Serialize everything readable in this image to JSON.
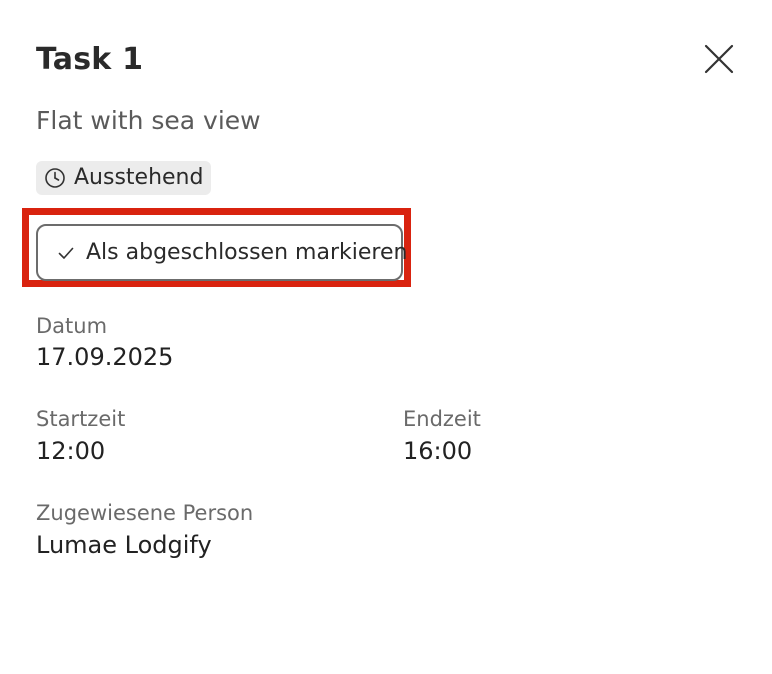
{
  "task": {
    "title": "Task 1",
    "property": "Flat with sea view",
    "status": {
      "label": "Ausstehend",
      "icon": "clock-icon"
    },
    "complete_button_label": "Als abgeschlossen markieren",
    "fields": {
      "date": {
        "label": "Datum",
        "value": "17.09.2025"
      },
      "start_time": {
        "label": "Startzeit",
        "value": "12:00"
      },
      "end_time": {
        "label": "Endzeit",
        "value": "16:00"
      },
      "assignee": {
        "label": "Zugewiesene Person",
        "value": "Lumae Lodgify"
      }
    }
  },
  "icons": {
    "close": "close-icon",
    "status": "clock-icon",
    "complete": "checkmark-icon"
  },
  "colors": {
    "highlight": "#d9230f",
    "badge_background": "#ececec",
    "button_border": "#6c6c6c"
  }
}
